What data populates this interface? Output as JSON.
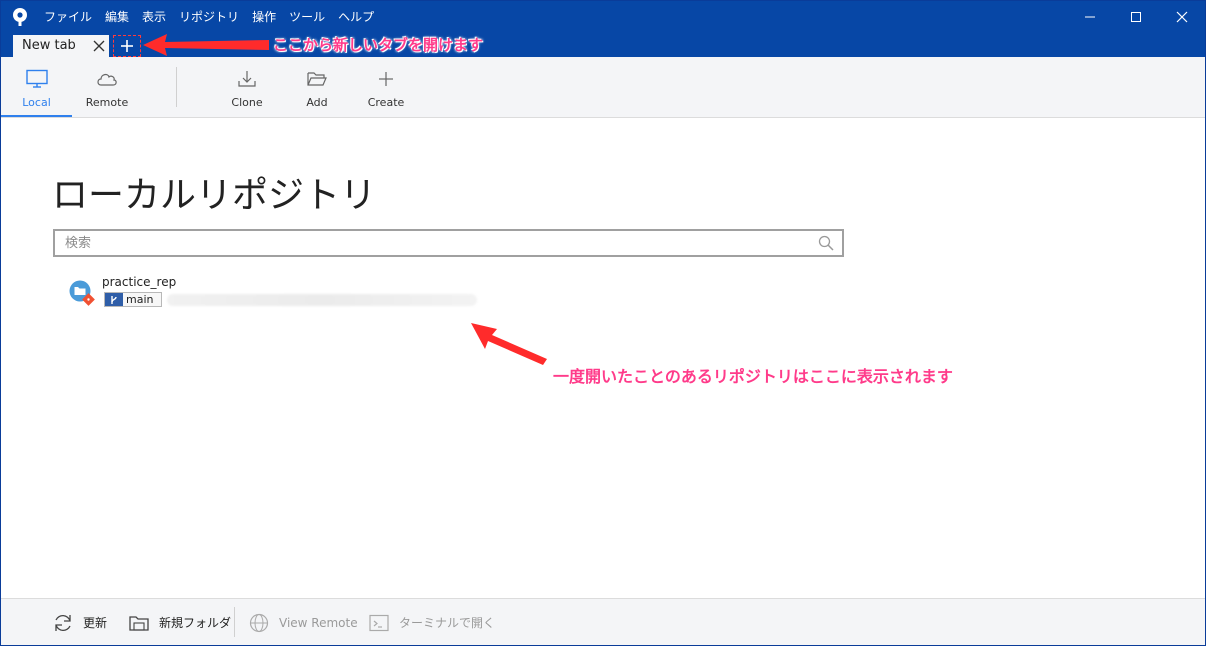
{
  "menu": [
    "ファイル",
    "編集",
    "表示",
    "リポジトリ",
    "操作",
    "ツール",
    "ヘルプ"
  ],
  "tab": {
    "label": "New tab"
  },
  "annotations": {
    "new_tab": "ここから新しいタブを開けます",
    "repo_list": "一度開いたことのあるリポジトリはここに表示されます"
  },
  "toolbar": {
    "local": "Local",
    "remote": "Remote",
    "clone": "Clone",
    "add": "Add",
    "create": "Create"
  },
  "main": {
    "title": "ローカルリポジトリ",
    "search_placeholder": "検索"
  },
  "repos": [
    {
      "name": "practice_rep",
      "branch": "main"
    }
  ],
  "footer": {
    "refresh": "更新",
    "new_folder": "新規フォルダ",
    "view_remote": "View Remote",
    "open_terminal": "ターミナルで開く"
  },
  "colors": {
    "titlebar": "#0747a6",
    "accent": "#2f80ed",
    "annotation": "#ff3b8a"
  }
}
